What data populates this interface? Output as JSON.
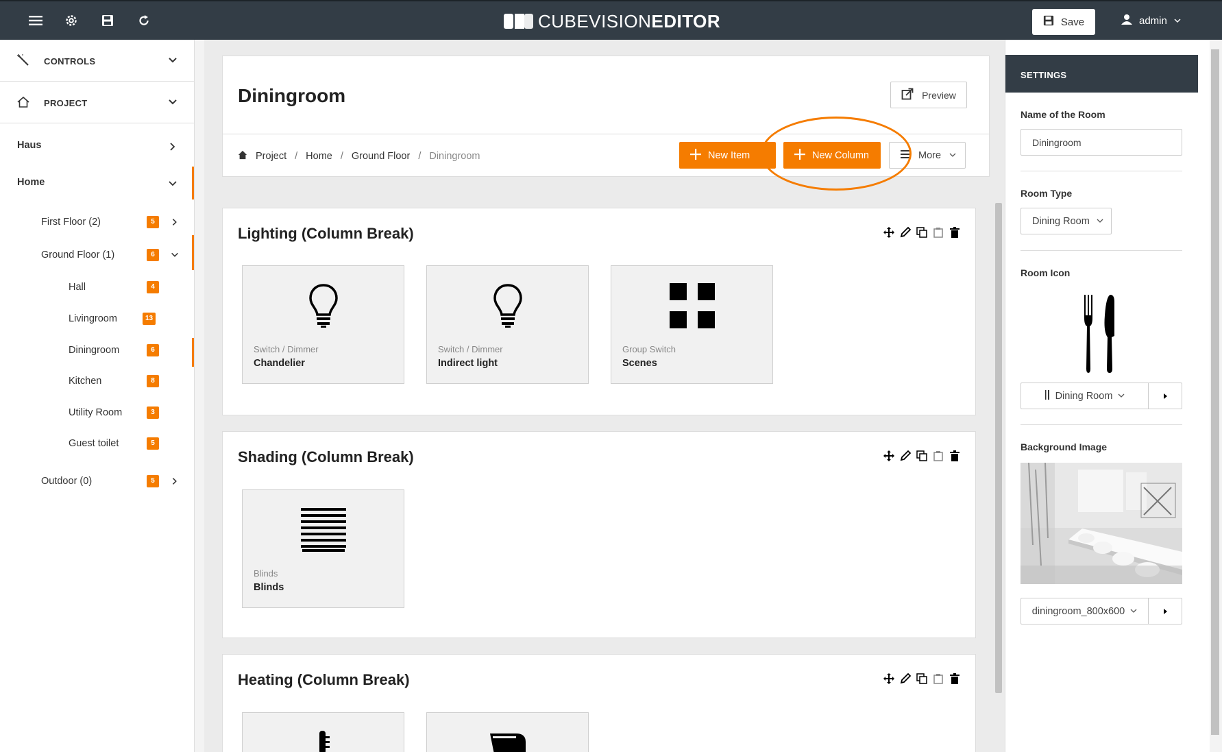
{
  "app": {
    "brand_light": "CUBEVISION",
    "brand_bold": "EDITOR"
  },
  "topbar": {
    "icons": [
      "menu-icon",
      "gear-icon",
      "floppy-icon",
      "refresh-icon"
    ],
    "save_label": "Save",
    "user_label": "admin"
  },
  "sidebar": {
    "controls_label": "CONTROLS",
    "project_label": "PROJECT",
    "haus_label": "Haus",
    "home_label": "Home",
    "first_floor": {
      "label": "First Floor (2)",
      "badge": "5"
    },
    "ground_floor": {
      "label": "Ground Floor (1)",
      "badge": "6"
    },
    "rooms": [
      {
        "label": "Hall",
        "badge": "4"
      },
      {
        "label": "Livingroom",
        "badge": "13"
      },
      {
        "label": "Diningroom",
        "badge": "6"
      },
      {
        "label": "Kitchen",
        "badge": "8"
      },
      {
        "label": "Utility Room",
        "badge": "3"
      },
      {
        "label": "Guest toilet",
        "badge": "5"
      }
    ],
    "outdoor": {
      "label": "Outdoor (0)",
      "badge": "5"
    }
  },
  "header": {
    "title": "Diningroom",
    "preview_label": "Preview",
    "breadcrumb": [
      "Project",
      "Home",
      "Ground Floor",
      "Diningroom"
    ],
    "new_item_label": "New Item",
    "new_column_label": "New Column",
    "more_label": "More"
  },
  "groups": [
    {
      "title": "Lighting (Column Break)",
      "tiles": [
        {
          "type": "Switch / Dimmer",
          "name": "Chandelier",
          "icon": "bulb-icon"
        },
        {
          "type": "Switch / Dimmer",
          "name": "Indirect light",
          "icon": "bulb-icon"
        },
        {
          "type": "Group Switch",
          "name": "Scenes",
          "icon": "grid-icon"
        }
      ]
    },
    {
      "title": "Shading (Column Break)",
      "tiles": [
        {
          "type": "Blinds",
          "name": "Blinds",
          "icon": "blinds-icon"
        }
      ]
    },
    {
      "title": "Heating (Column Break)",
      "tiles": [
        {
          "type": "",
          "name": "",
          "icon": "thermometer-icon"
        },
        {
          "type": "",
          "name": "",
          "icon": "radiator-icon"
        }
      ]
    }
  ],
  "settings": {
    "header": "SETTINGS",
    "name_label": "Name of the Room",
    "name_value": "Diningroom",
    "type_label": "Room Type",
    "type_value": "Dining Room",
    "icon_label": "Room Icon",
    "icon_value": "Dining Room",
    "bg_label": "Background Image",
    "bg_value": "diningroom_800x600"
  },
  "colors": {
    "accent": "#f57c00",
    "topbar": "#333d46"
  }
}
